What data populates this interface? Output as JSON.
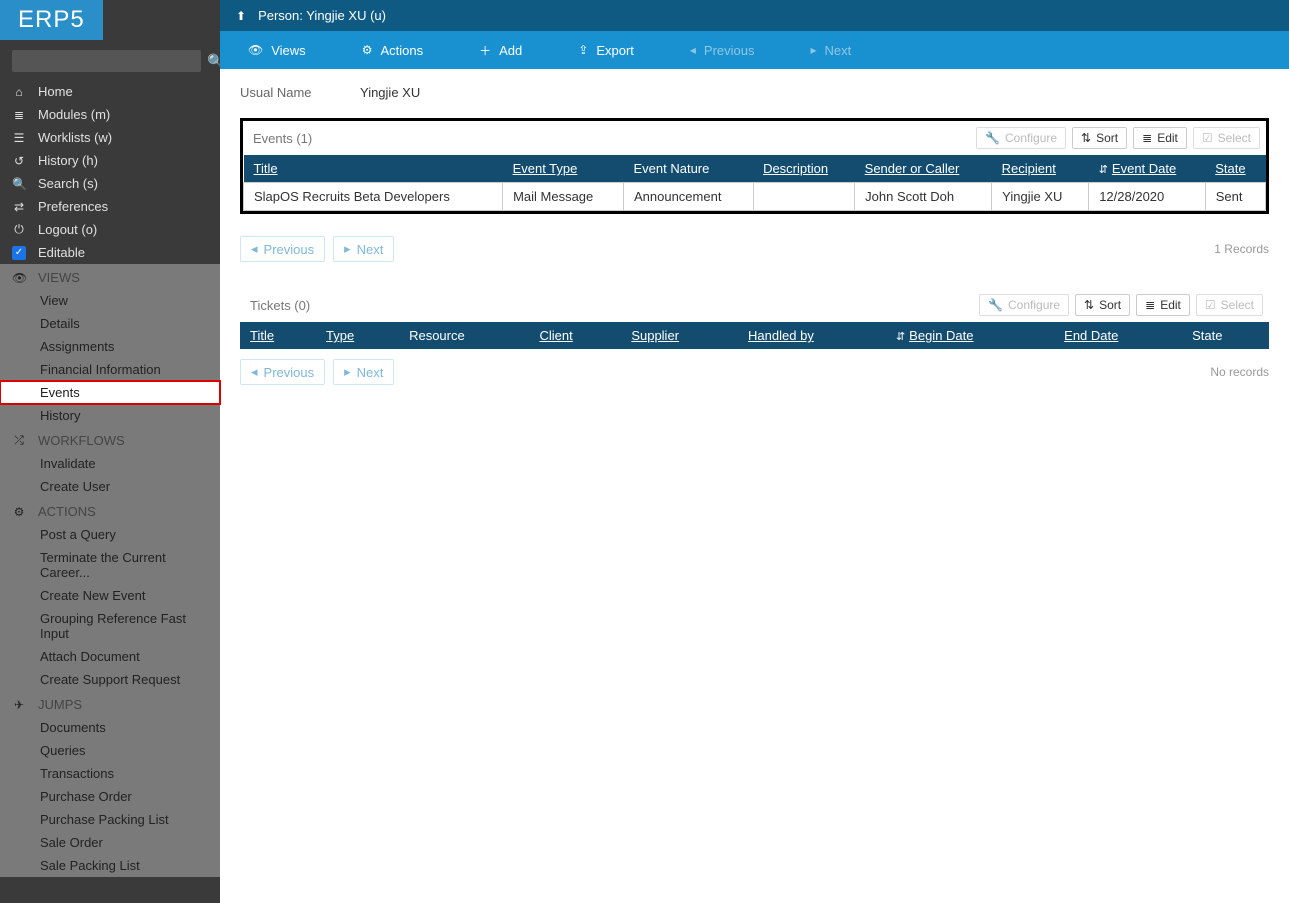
{
  "logo": "ERP5",
  "sidebar": {
    "search_placeholder": "",
    "main_nav": [
      {
        "icon": "⌂",
        "label": "Home"
      },
      {
        "icon": "≣",
        "label": "Modules (m)"
      },
      {
        "icon": "☰",
        "label": "Worklists (w)"
      },
      {
        "icon": "↺",
        "label": "History (h)"
      },
      {
        "icon": "🔍",
        "label": "Search (s)"
      },
      {
        "icon": "⇄",
        "label": "Preferences"
      },
      {
        "icon": "⏻",
        "label": "Logout (o)"
      }
    ],
    "editable_label": "Editable",
    "views_header": "VIEWS",
    "views": [
      "View",
      "Details",
      "Assignments",
      "Financial Information",
      "Events",
      "History"
    ],
    "workflows_header": "WORKFLOWS",
    "workflows": [
      "Invalidate",
      "Create User"
    ],
    "actions_header": "ACTIONS",
    "actions": [
      "Post a Query",
      "Terminate the Current Career...",
      "Create New Event",
      "Grouping Reference Fast Input",
      "Attach Document",
      "Create Support Request"
    ],
    "jumps_header": "JUMPS",
    "jumps": [
      "Documents",
      "Queries",
      "Transactions",
      "Purchase Order",
      "Purchase Packing List",
      "Sale Order",
      "Sale Packing List"
    ]
  },
  "title_bar": {
    "breadcrumb": "Person: Yingjie XU (u)"
  },
  "action_bar": {
    "views": "Views",
    "actions": "Actions",
    "add": "Add",
    "export": "Export",
    "previous": "Previous",
    "next": "Next"
  },
  "field": {
    "label": "Usual Name",
    "value": "Yingjie XU"
  },
  "events_panel": {
    "title": "Events (1)",
    "tools": {
      "configure": "Configure",
      "sort": "Sort",
      "edit": "Edit",
      "select": "Select"
    },
    "columns": {
      "title": "Title",
      "event_type": "Event Type",
      "event_nature": "Event Nature",
      "description": "Description",
      "sender": "Sender or Caller",
      "recipient": "Recipient",
      "event_date": "Event Date",
      "state": "State"
    },
    "rows": [
      {
        "title": "SlapOS Recruits Beta Developers",
        "event_type": "Mail Message",
        "event_nature": "Announcement",
        "description": "",
        "sender": "John Scott Doh",
        "recipient": "Yingjie XU",
        "event_date": "12/28/2020",
        "state": "Sent"
      }
    ],
    "records": "1 Records",
    "prev": "Previous",
    "next": "Next"
  },
  "tickets_panel": {
    "title": "Tickets (0)",
    "tools": {
      "configure": "Configure",
      "sort": "Sort",
      "edit": "Edit",
      "select": "Select"
    },
    "columns": {
      "title": "Title",
      "type": "Type",
      "resource": "Resource",
      "client": "Client",
      "supplier": "Supplier",
      "handled_by": "Handled by",
      "begin_date": "Begin Date",
      "end_date": "End Date",
      "state": "State"
    },
    "records": "No records",
    "prev": "Previous",
    "next": "Next"
  }
}
